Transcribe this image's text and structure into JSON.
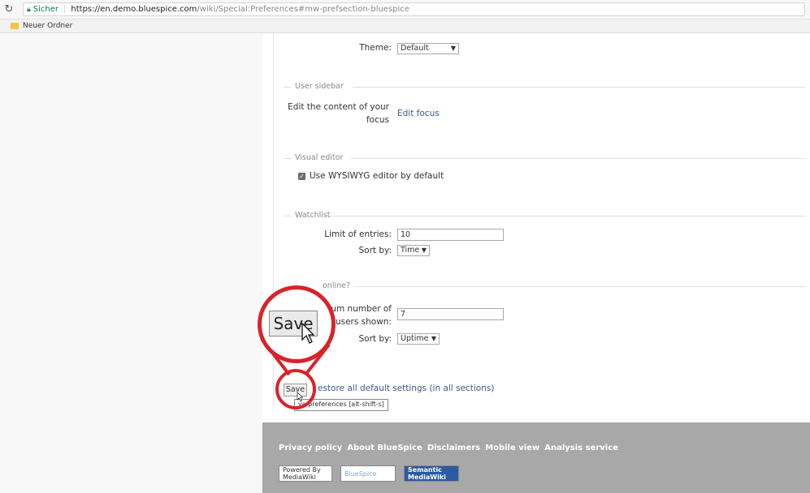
{
  "browser": {
    "secure_label": "Sicher",
    "url_host": "https://en.demo.bluespice.com",
    "url_path": "/wiki/Special:Preferences#mw-prefsection-bluespice",
    "bookmark_folder": "Neuer Ordner"
  },
  "theme": {
    "label": "Theme:",
    "value": "Default"
  },
  "user_sidebar": {
    "legend": "User sidebar",
    "label_line1": "Edit the content of your",
    "label_line2": "focus",
    "link": "Edit focus"
  },
  "visual_editor": {
    "legend": "Visual editor",
    "checkbox_label": "Use WYSIWYG editor by default",
    "checked": true
  },
  "watchlist": {
    "legend": "Watchlist",
    "limit_label": "Limit of entries:",
    "limit_value": "10",
    "sort_label": "Sort by:",
    "sort_value": "Time"
  },
  "whos_online": {
    "legend_partial": "online?",
    "max_label_line1": "um number of",
    "max_label_line2": "users shown:",
    "max_value": "7",
    "sort_label": "Sort by:",
    "sort_value": "Uptime"
  },
  "actions": {
    "save_label": "Save",
    "restore_label": "estore all default settings (in all sections)",
    "tooltip": "ve preferences [alt-shift-s]"
  },
  "zoom": {
    "save_label": "Save"
  },
  "footer": {
    "links": [
      "Privacy policy",
      "About BlueSpice",
      "Disclaimers",
      "Mobile view",
      "Analysis service"
    ],
    "badges": {
      "mediawiki": "Powered By MediaWiki",
      "bluespice": "BlueSpice",
      "smw": "Semantic MediaWiki"
    }
  },
  "colors": {
    "accent_red": "#d9232a",
    "link_blue": "#3a5a8c",
    "footer_gray": "#a8a8a8"
  }
}
